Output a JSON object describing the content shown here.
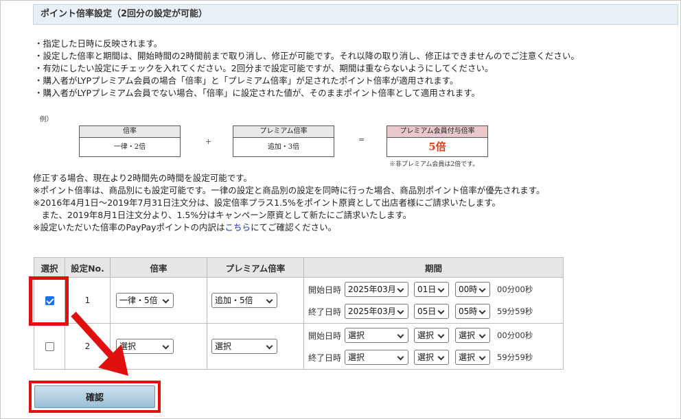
{
  "header": {
    "title": "ポイント倍率設定（2回分の設定が可能）"
  },
  "notes": [
    "・指定した日時に反映されます。",
    "・設定した倍率と期間は、開始時間の2時間前まで取り消し、修正が可能です。それ以降の取り消し、修正はできませんのでご注意ください。",
    "・有効にしたい設定にチェックを入れてください。2回分まで設定可能ですが、期間は重ならないようにしてください。",
    "・購入者がLYPプレミアム会員の場合「倍率」と「プレミアム倍率」が足されたポイント倍率が適用されます。",
    "・購入者がLYPプレミアム会員でない場合、「倍率」に設定された値が、そのままポイント倍率として適用されます。"
  ],
  "example": {
    "label": "例）",
    "box1": {
      "head": "倍率",
      "body": "一律・2倍"
    },
    "plus": "+",
    "box2": {
      "head": "プレミアム倍率",
      "body": "追加・3倍"
    },
    "equals": "=",
    "box3": {
      "head": "プレミアム会員付与倍率",
      "body": "5倍"
    },
    "note": "※非プレミアム会員は2倍です。"
  },
  "notes2": [
    "修正する場合、現在より2時間先の時間を設定可能です。",
    "※ポイント倍率は、商品別にも設定可能です。一律の設定と商品別の設定を同時に行った場合、商品別ポイント倍率が優先されます。",
    "※2016年4月1日～2019年7月31日注文分は、設定倍率プラス1.5%をポイント原資として出店者様にご請求いたします。",
    "　また、2019年8月1日注文分より、1.5%分はキャンペーン原資として新たにご請求いたします。"
  ],
  "notes2_last": {
    "before": "※設定いただいた倍率のPayPayポイントの内訳は",
    "link": "こちら",
    "after": "にてご確認ください。"
  },
  "table": {
    "headers": [
      "選択",
      "設定No.",
      "倍率",
      "プレミアム倍率",
      "期間"
    ],
    "start_label": "開始日時",
    "end_label": "終了日時",
    "rows": [
      {
        "checked": true,
        "no": "1",
        "rate": "一律・5倍",
        "premium": "追加・5倍",
        "start": {
          "month": "2025年03月",
          "day": "01日",
          "hour": "00時",
          "sec": "00分00秒"
        },
        "end": {
          "month": "2025年03月",
          "day": "05日",
          "hour": "05時",
          "sec": "59分59秒"
        }
      },
      {
        "checked": false,
        "no": "2",
        "rate": "選択",
        "premium": "選択",
        "start": {
          "month": "選択",
          "day": "選択",
          "hour": "選択",
          "sec": "00分00秒"
        },
        "end": {
          "month": "選択",
          "day": "選択",
          "hour": "選択",
          "sec": "59分59秒"
        }
      }
    ]
  },
  "confirm_label": "確認",
  "colors": {
    "highlight": "#e01010",
    "header_bg": "#e8f0f6",
    "link": "#1a33b8",
    "result": "#e23b1a"
  }
}
